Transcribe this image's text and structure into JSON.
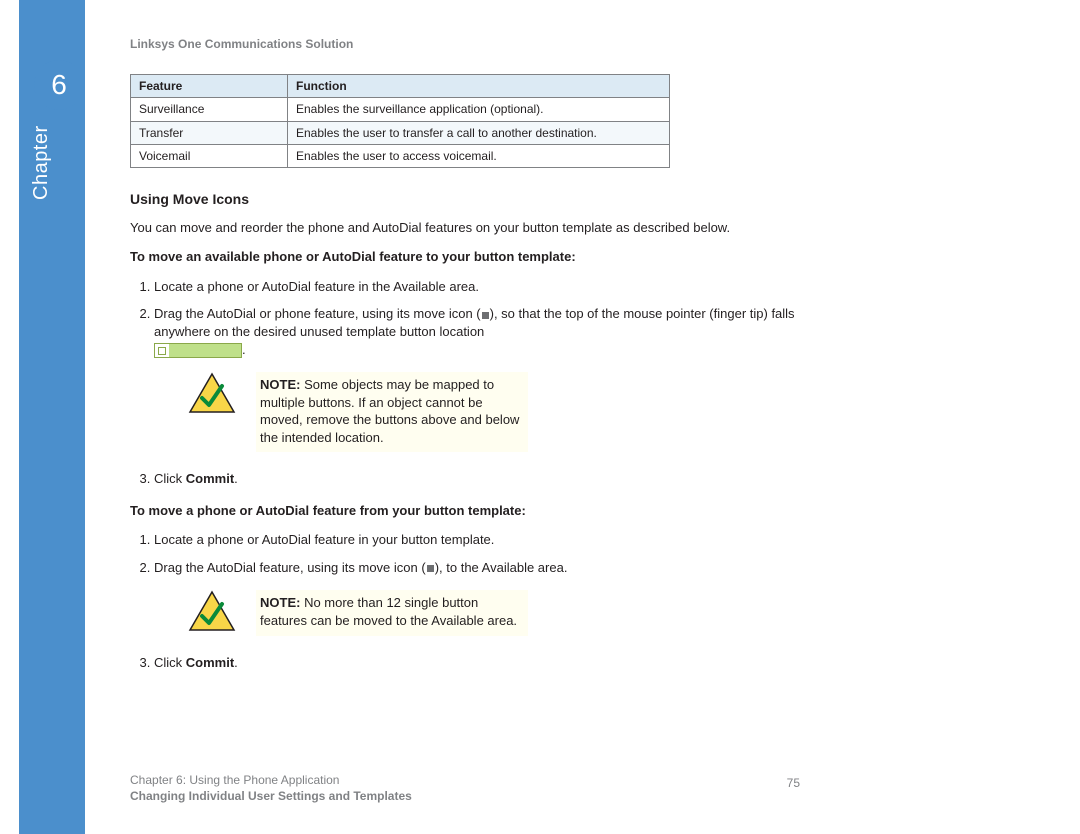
{
  "chapter": {
    "number": "6",
    "label": "Chapter"
  },
  "doc_header": "Linksys One Communications Solution",
  "table": {
    "head": {
      "c1": "Feature",
      "c2": "Function"
    },
    "rows": [
      {
        "c1": "Surveillance",
        "c2": "Enables the surveillance application (optional)."
      },
      {
        "c1": "Transfer",
        "c2": "Enables the user to transfer a call to another destination."
      },
      {
        "c1": "Voicemail",
        "c2": "Enables the user to access voicemail."
      }
    ]
  },
  "h2": "Using Move Icons",
  "intro": "You can move and reorder the phone and AutoDial features on your button template as described below.",
  "proc1": {
    "title": "To move an available phone or AutoDial feature to your button template:",
    "s1": "Locate a phone or AutoDial feature in the Available area.",
    "s2a": "Drag the AutoDial or phone feature, using its move icon (",
    "s2b": "), so that the top of the mouse pointer (finger tip) falls anywhere on the desired unused template button location ",
    "s2c": ".",
    "note_label": "NOTE:",
    "note": " Some objects may be mapped to multiple buttons. If an object cannot be moved, remove the buttons above and below the intended location.",
    "s3a": "Click ",
    "s3b": "Commit",
    "s3c": "."
  },
  "proc2": {
    "title": "To move a phone or AutoDial feature from your button template:",
    "s1": "Locate a phone or AutoDial feature in your button template.",
    "s2a": "Drag the AutoDial feature, using its move icon (",
    "s2b": "), to the Available area.",
    "note_label": "NOTE:",
    "note": " No more than 12 single button features can be moved to the Available area.",
    "s3a": "Click ",
    "s3b": "Commit",
    "s3c": "."
  },
  "footer": {
    "line1": "Chapter 6: Using the Phone Application",
    "line2": "Changing Individual User Settings and Templates",
    "page": "75"
  }
}
